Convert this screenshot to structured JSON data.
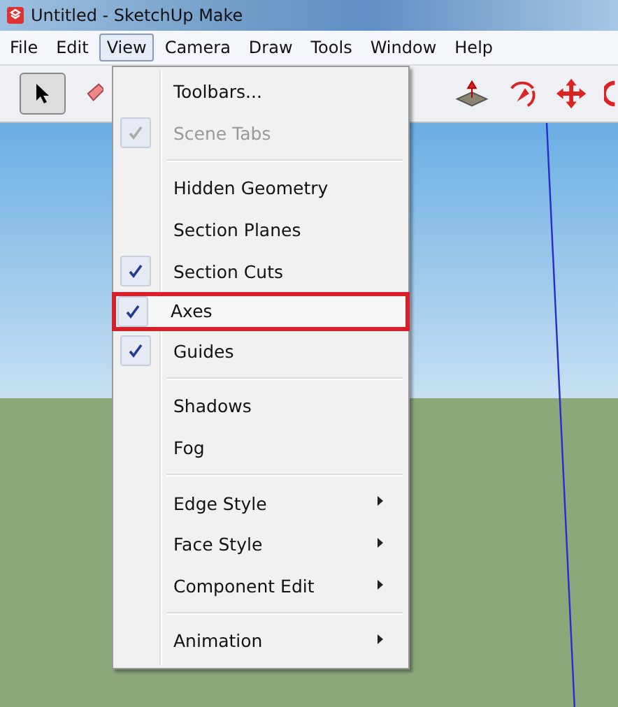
{
  "window": {
    "title": "Untitled - SketchUp Make"
  },
  "menubar": [
    {
      "label": "File",
      "selected": false
    },
    {
      "label": "Edit",
      "selected": false
    },
    {
      "label": "View",
      "selected": true
    },
    {
      "label": "Camera",
      "selected": false
    },
    {
      "label": "Draw",
      "selected": false
    },
    {
      "label": "Tools",
      "selected": false
    },
    {
      "label": "Window",
      "selected": false
    },
    {
      "label": "Help",
      "selected": false
    }
  ],
  "menu_sections": [
    [
      {
        "label": "Toolbars...",
        "checked": false,
        "disabled": false,
        "submenu": false,
        "highlighted": false
      },
      {
        "label": "Scene Tabs",
        "checked": true,
        "disabled": true,
        "submenu": false,
        "highlighted": false
      }
    ],
    [
      {
        "label": "Hidden Geometry",
        "checked": false,
        "disabled": false,
        "submenu": false,
        "highlighted": false
      },
      {
        "label": "Section Planes",
        "checked": false,
        "disabled": false,
        "submenu": false,
        "highlighted": false
      },
      {
        "label": "Section Cuts",
        "checked": true,
        "disabled": false,
        "submenu": false,
        "highlighted": false
      },
      {
        "label": "Axes",
        "checked": true,
        "disabled": false,
        "submenu": false,
        "highlighted": true
      },
      {
        "label": "Guides",
        "checked": true,
        "disabled": false,
        "submenu": false,
        "highlighted": false
      }
    ],
    [
      {
        "label": "Shadows",
        "checked": false,
        "disabled": false,
        "submenu": false,
        "highlighted": false
      },
      {
        "label": "Fog",
        "checked": false,
        "disabled": false,
        "submenu": false,
        "highlighted": false
      }
    ],
    [
      {
        "label": "Edge Style",
        "checked": false,
        "disabled": false,
        "submenu": true,
        "highlighted": false
      },
      {
        "label": "Face Style",
        "checked": false,
        "disabled": false,
        "submenu": true,
        "highlighted": false
      },
      {
        "label": "Component Edit",
        "checked": false,
        "disabled": false,
        "submenu": true,
        "highlighted": false
      }
    ],
    [
      {
        "label": "Animation",
        "checked": false,
        "disabled": false,
        "submenu": true,
        "highlighted": false
      }
    ]
  ]
}
